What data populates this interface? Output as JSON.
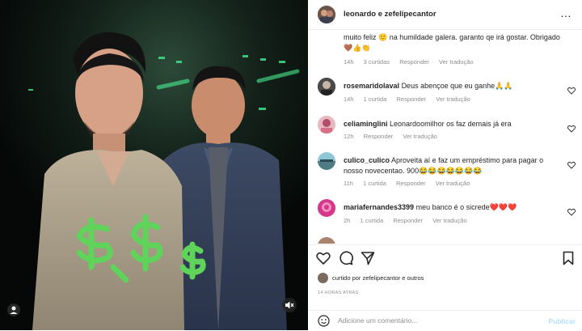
{
  "header": {
    "username": "leonardo e zefelipecantor",
    "more": "…"
  },
  "comments": [
    {
      "user": "",
      "text": "muito feliz 🙂 na humildade galera. garanto qe irá gostar. Obrigado 🤎👍👏",
      "age": "14h",
      "likes": "3 curtidas",
      "reply": "Responder",
      "translate": "Ver tradução"
    },
    {
      "user": "rosemaridolaval",
      "text": "Deus abençoe que eu ganhe🙏🙏",
      "age": "14h",
      "likes": "1 curtida",
      "reply": "Responder",
      "translate": "Ver tradução"
    },
    {
      "user": "celiaminglini",
      "text": "Leonardoomilhor os faz demais já era",
      "age": "12h",
      "likes": "",
      "reply": "Responder",
      "translate": "Ver tradução"
    },
    {
      "user": "culico_culico",
      "text": "Aproveita aí e faz um empréstimo para pagar o nosso novecentao. 900😂😂😂😂😂😂😂",
      "age": "11h",
      "likes": "1 curtida",
      "reply": "Responder",
      "translate": "Ver tradução"
    },
    {
      "user": "mariafernandes3399",
      "text": "meu banco é o sicrede❤️❤️❤️",
      "age": "2h",
      "likes": "1 curtida",
      "reply": "Responder",
      "translate": "Ver tradução"
    }
  ],
  "liked_by": "curtido por zefelipecantor e outros",
  "timestamp": "14 HORAS ATRÁS",
  "add_comment": {
    "placeholder": "Adicione um comentário...",
    "post_label": "Publicar"
  },
  "colors": {
    "accent_green": "#5fd35a",
    "post_disabled": "#b2dffc",
    "meta_gray": "#8e8e8e"
  }
}
